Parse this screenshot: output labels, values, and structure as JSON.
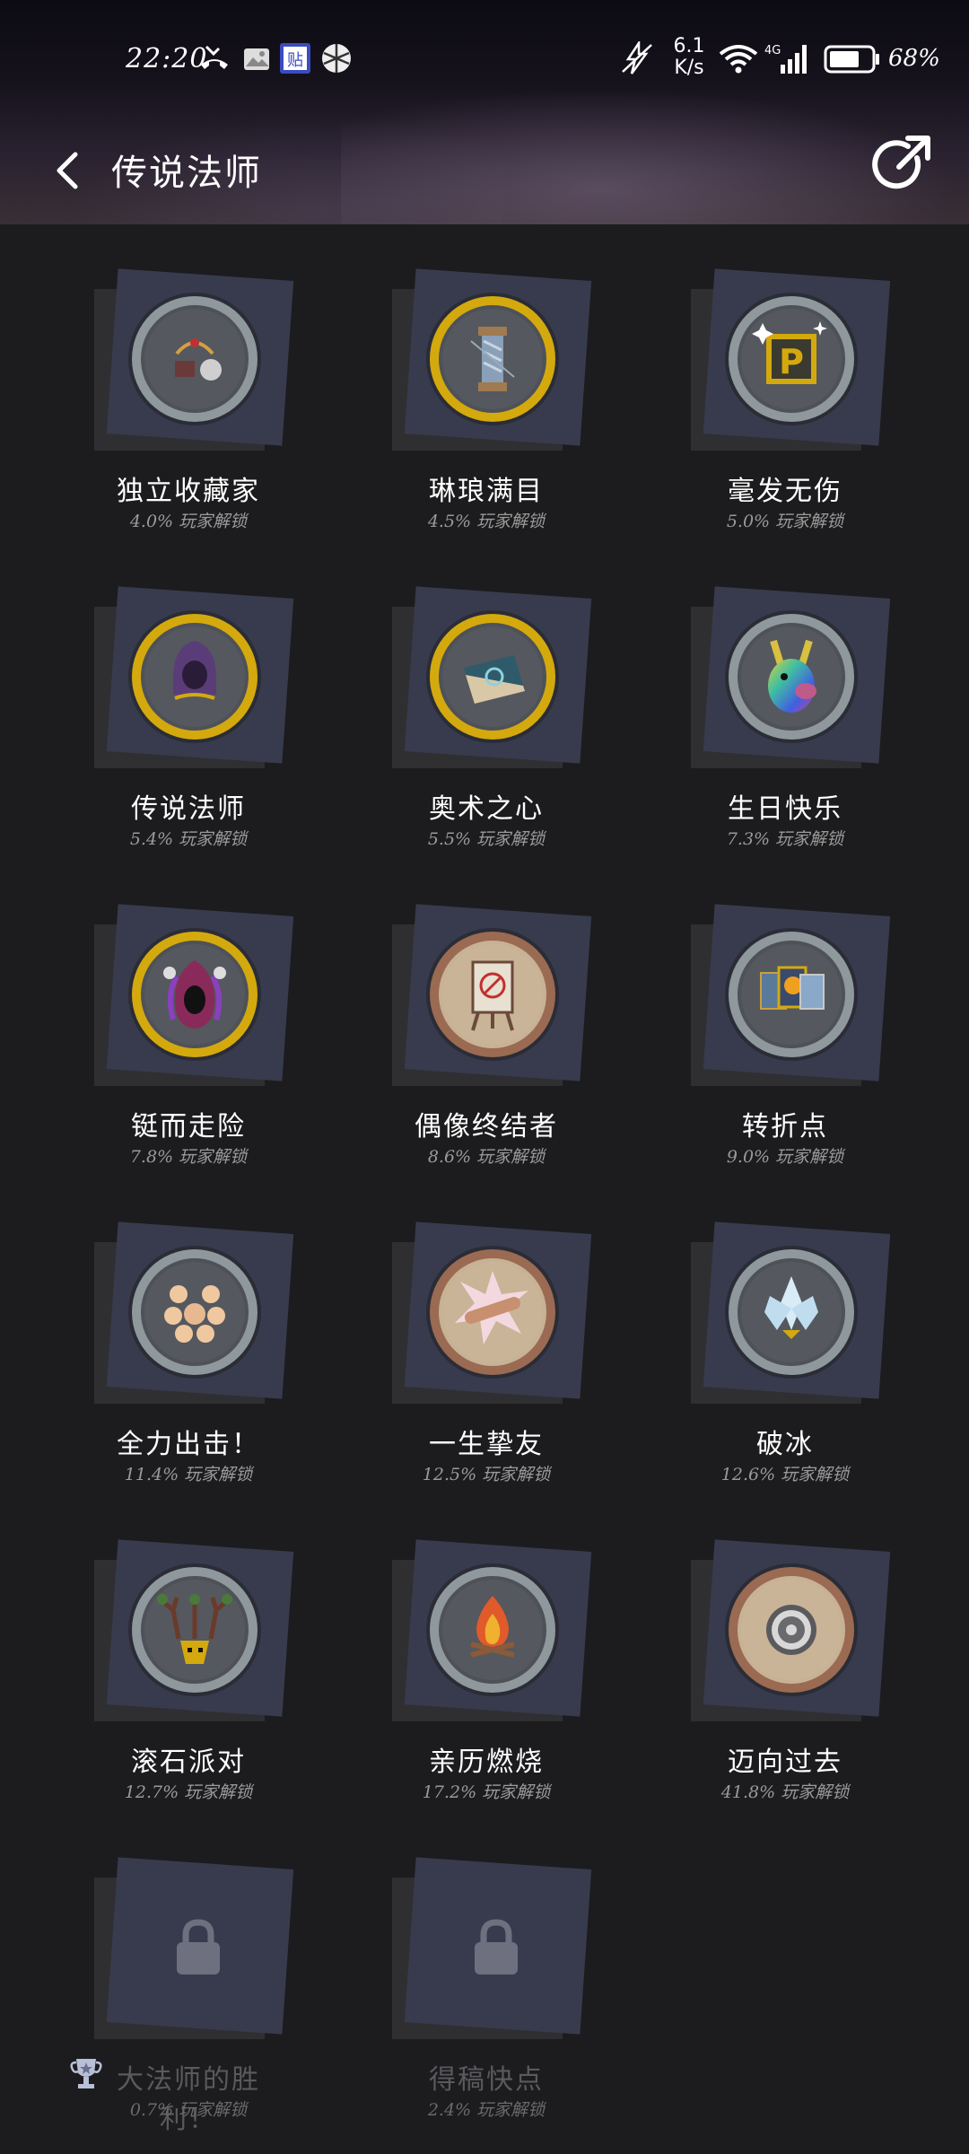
{
  "status_bar": {
    "time": "22:20",
    "net_speed_value": "6.1",
    "net_speed_unit": "K/s",
    "network_type": "4G",
    "battery_percent": "68%"
  },
  "nav": {
    "title": "传说法师"
  },
  "achievements": [
    {
      "name": "独立收藏家",
      "rate": "4.0% 玩家解锁",
      "badge": "bag-items-icon",
      "rim": "silver"
    },
    {
      "name": "琳琅满目",
      "rate": "4.5% 玩家解锁",
      "badge": "thread-spool-icon",
      "rim": "gold"
    },
    {
      "name": "毫发无伤",
      "rate": "5.0% 玩家解锁",
      "badge": "p-block-icon",
      "rim": "silver"
    },
    {
      "name": "传说法师",
      "rate": "5.4% 玩家解锁",
      "badge": "hooded-cloak-icon",
      "rim": "gold"
    },
    {
      "name": "奥术之心",
      "rate": "5.5% 玩家解锁",
      "badge": "spellbook-icon",
      "rim": "gold"
    },
    {
      "name": "生日快乐",
      "rate": "7.3% 玩家解锁",
      "badge": "rainbow-llama-icon",
      "rim": "silver"
    },
    {
      "name": "铤而走险",
      "rate": "7.8% 玩家解锁",
      "badge": "hooded-skull-icon",
      "rim": "gold"
    },
    {
      "name": "偶像终结者",
      "rate": "8.6% 玩家解锁",
      "badge": "easel-icon",
      "rim": "bronze"
    },
    {
      "name": "转折点",
      "rate": "9.0% 玩家解锁",
      "badge": "cards-icon",
      "rim": "silver"
    },
    {
      "name": "全力出击！",
      "rate": "11.4% 玩家解锁",
      "badge": "fists-icon",
      "rim": "silver"
    },
    {
      "name": "一生挚友",
      "rate": "12.5% 玩家解锁",
      "badge": "handshake-icon",
      "rim": "bronze"
    },
    {
      "name": "破冰",
      "rate": "12.6% 玩家解锁",
      "badge": "ice-crystal-icon",
      "rim": "silver"
    },
    {
      "name": "滚石派对",
      "rate": "12.7% 玩家解锁",
      "badge": "antler-mask-icon",
      "rim": "silver"
    },
    {
      "name": "亲历燃烧",
      "rate": "17.2% 玩家解锁",
      "badge": "campfire-icon",
      "rim": "silver"
    },
    {
      "name": "迈向过去",
      "rate": "41.8% 玩家解锁",
      "badge": "relic-disc-icon",
      "rim": "bronze"
    },
    {
      "name": "大法师的胜利！",
      "rate": "0.7% 玩家解锁",
      "badge": "lock-icon",
      "rim": "locked"
    },
    {
      "name": "得稿快点",
      "rate": "2.4% 玩家解锁",
      "badge": "lock-icon",
      "rim": "locked"
    }
  ],
  "colors": {
    "background": "#1c1c1e",
    "card": "#383b4d",
    "gold_rim": "#d4a90e",
    "silver_rim": "#8f989c",
    "bronze_rim": "#9a6a52"
  }
}
